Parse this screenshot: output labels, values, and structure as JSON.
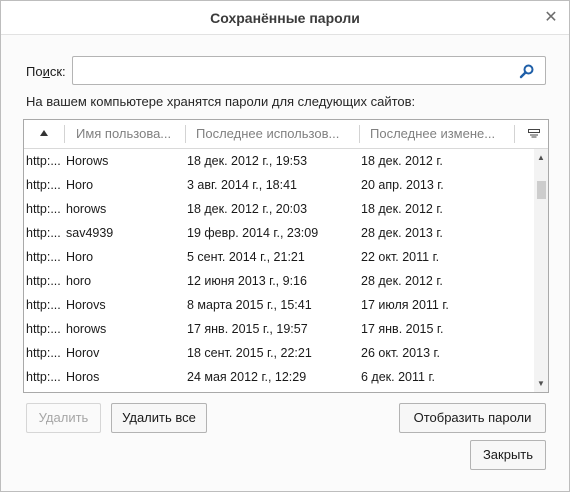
{
  "window": {
    "title": "Сохранённые пароли",
    "close_glyph": "✕"
  },
  "search": {
    "label_accel": "и",
    "label_prefix": "По",
    "label_suffix": "ск:",
    "value": "",
    "placeholder": "",
    "icon": "search-icon"
  },
  "info_text": "На вашем компьютере хранятся пароли для следующих сайтов:",
  "table": {
    "columns": {
      "site": "",
      "user": "Имя пользова...",
      "last_used": "Последнее использов...",
      "last_changed": "Последнее измене..."
    },
    "rows": [
      {
        "site": "http:...",
        "user": "Horows",
        "last_used": "18 дек. 2012 г., 19:53",
        "last_changed": "18 дек. 2012 г."
      },
      {
        "site": "http:...",
        "user": "Horo",
        "last_used": "3 авг. 2014 г., 18:41",
        "last_changed": "20 апр. 2013 г."
      },
      {
        "site": "http:...",
        "user": "horows",
        "last_used": "18 дек. 2012 г., 20:03",
        "last_changed": "18 дек. 2012 г."
      },
      {
        "site": "http:...",
        "user": "sav4939",
        "last_used": "19 февр. 2014 г., 23:09",
        "last_changed": "28 дек. 2013 г."
      },
      {
        "site": "http:...",
        "user": "Horo",
        "last_used": "5 сент. 2014 г., 21:21",
        "last_changed": "22 окт. 2011 г."
      },
      {
        "site": "http:...",
        "user": "horo",
        "last_used": "12 июня 2013 г., 9:16",
        "last_changed": "28 дек. 2012 г."
      },
      {
        "site": "http:...",
        "user": "Horovs",
        "last_used": "8 марта 2015 г., 15:41",
        "last_changed": "17 июля 2011 г."
      },
      {
        "site": "http:...",
        "user": "horows",
        "last_used": "17 янв. 2015 г., 19:57",
        "last_changed": "17 янв. 2015 г."
      },
      {
        "site": "http:...",
        "user": "Horov",
        "last_used": "18 сент. 2015 г., 22:21",
        "last_changed": "26 окт. 2013 г."
      },
      {
        "site": "http:...",
        "user": "Horos",
        "last_used": "24 мая 2012 г., 12:29",
        "last_changed": "6 дек. 2011 г."
      }
    ]
  },
  "buttons": {
    "delete": "Удалить",
    "delete_all": "Удалить все",
    "show_passwords": "Отобразить пароли",
    "close": "Закрыть"
  }
}
